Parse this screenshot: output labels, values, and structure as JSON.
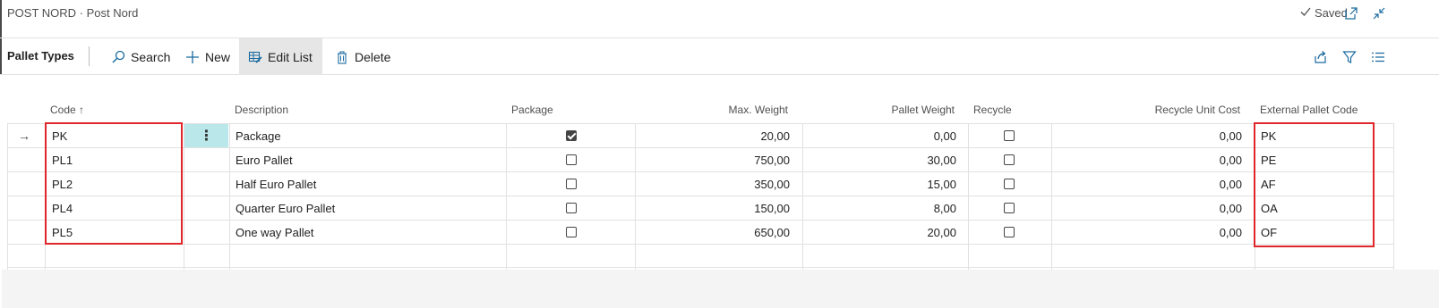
{
  "window": {
    "title": "POST NORD · Post Nord",
    "saved_label": "Saved"
  },
  "actionbar": {
    "page_name": "Pallet Types",
    "search_label": "Search",
    "new_label": "New",
    "edit_list_label": "Edit List",
    "delete_label": "Delete"
  },
  "columns": {
    "code": "Code",
    "code_sort": "↑",
    "description": "Description",
    "package": "Package",
    "max_weight": "Max. Weight",
    "pallet_weight": "Pallet Weight",
    "recycle": "Recycle",
    "recycle_unit_cost": "Recycle Unit Cost",
    "external_pallet_code": "External Pallet Code"
  },
  "rows": [
    {
      "code": "PK",
      "description": "Package",
      "package": true,
      "max_weight": "20,00",
      "pallet_weight": "0,00",
      "recycle": false,
      "recycle_unit_cost": "0,00",
      "external_pallet_code": "PK"
    },
    {
      "code": "PL1",
      "description": "Euro Pallet",
      "package": false,
      "max_weight": "750,00",
      "pallet_weight": "30,00",
      "recycle": false,
      "recycle_unit_cost": "0,00",
      "external_pallet_code": "PE"
    },
    {
      "code": "PL2",
      "description": "Half Euro Pallet",
      "package": false,
      "max_weight": "350,00",
      "pallet_weight": "15,00",
      "recycle": false,
      "recycle_unit_cost": "0,00",
      "external_pallet_code": "AF"
    },
    {
      "code": "PL4",
      "description": "Quarter Euro Pallet",
      "package": false,
      "max_weight": "150,00",
      "pallet_weight": "8,00",
      "recycle": false,
      "recycle_unit_cost": "0,00",
      "external_pallet_code": "OA"
    },
    {
      "code": "PL5",
      "description": "One way Pallet",
      "package": false,
      "max_weight": "650,00",
      "pallet_weight": "20,00",
      "recycle": false,
      "recycle_unit_cost": "0,00",
      "external_pallet_code": "OF"
    }
  ],
  "colors": {
    "accent": "#1a6aa0",
    "highlight_box": "#e0262b",
    "row_menu_bg": "#b9e7ea"
  }
}
